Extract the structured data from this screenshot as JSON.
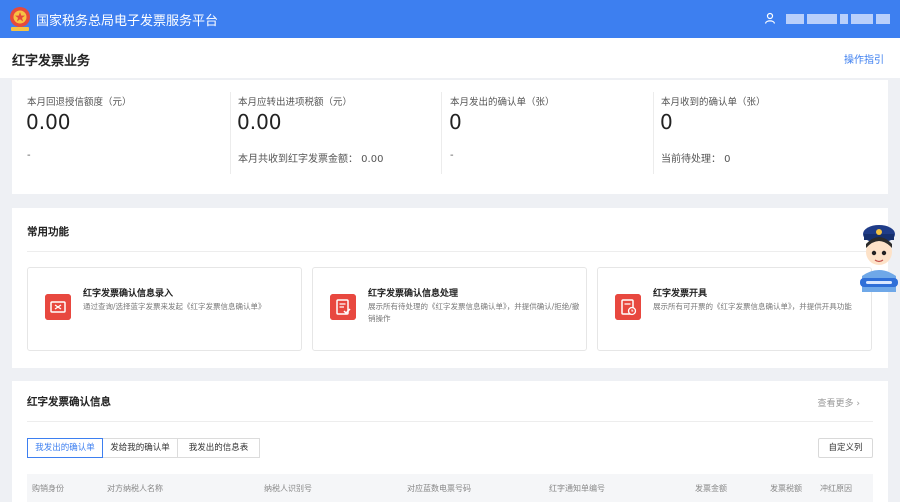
{
  "header": {
    "app_title": "国家税务总局电子发票服务平台"
  },
  "subheader": {
    "page_title": "红字发票业务",
    "guide_link": "操作指引"
  },
  "stats": [
    {
      "label": "本月回退授信额度（元）",
      "value": "0.00",
      "sub": "-"
    },
    {
      "label": "本月应转出进项税额（元）",
      "value": "0.00",
      "sub": "本月共收到红字发票金额：  0.00"
    },
    {
      "label": "本月发出的确认单（张）",
      "value": "0",
      "sub": "-"
    },
    {
      "label": "本月收到的确认单（张）",
      "value": "0",
      "sub": "当前待处理：  0"
    }
  ],
  "common_functions": {
    "title": "常用功能",
    "cards": [
      {
        "title": "红字发票确认信息录入",
        "desc": "通过查询/选择蓝字发票来发起《红字发票信息确认单》"
      },
      {
        "title": "红字发票确认信息处理",
        "desc": "展示所有待处理的《红字发票信息确认单》，并提供确认/拒绝/撤销操作"
      },
      {
        "title": "红字发票开具",
        "desc": "展示所有可开票的《红字发票信息确认单》，并提供开具功能"
      }
    ]
  },
  "confirm_info": {
    "title": "红字发票确认信息",
    "more_link": "查看更多 ›",
    "tabs": [
      "我发出的确认单",
      "发给我的确认单",
      "我发出的信息表"
    ],
    "active_tab": 0,
    "custom_columns": "自定义列",
    "columns": [
      "购销身份",
      "对方纳税人名称",
      "纳税人识别号",
      "对应蓝数电票号码",
      "红字通知单编号",
      "发票金额",
      "发票税额",
      "冲红原因"
    ]
  },
  "colors": {
    "brand_blue": "#3d7ff0",
    "icon_red": "#e8483f"
  }
}
